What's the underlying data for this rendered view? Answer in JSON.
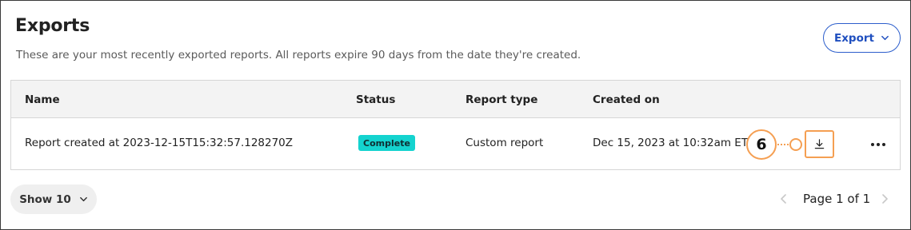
{
  "header": {
    "title": "Exports",
    "subtitle": "These are your most recently exported reports. All reports expire 90 days from the date they're created.",
    "export_label": "Export"
  },
  "table": {
    "columns": [
      "Name",
      "Status",
      "Report type",
      "Created on"
    ],
    "rows": [
      {
        "name": "Report created at 2023-12-15T15:32:57.128270Z",
        "status": "Complete",
        "report_type": "Custom report",
        "created_on": "Dec 15, 2023 at 10:32am ET"
      }
    ]
  },
  "annotation": {
    "step": "6"
  },
  "footer": {
    "page_size_label": "Show 10",
    "pagination_text": "Page 1 of 1"
  },
  "icons": {
    "export_chevron": "chevron-down-icon",
    "download": "download-icon",
    "more": "more-horizontal-icon",
    "prev": "chevron-left-icon",
    "next": "chevron-right-icon"
  },
  "colors": {
    "accent": "#2c5ecc",
    "badge_complete": "#14d3cf",
    "annotation": "#f59f52",
    "header_row_bg": "#f3f3f3"
  }
}
